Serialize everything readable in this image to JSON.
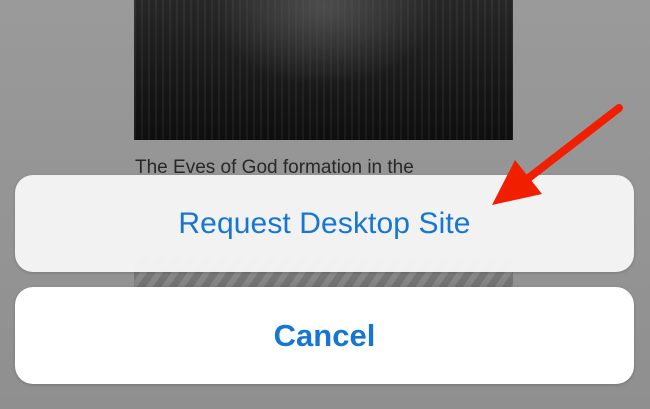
{
  "page": {
    "caption": "The Eves of God formation in the"
  },
  "actions": {
    "request_desktop_site_label": "Request Desktop Site",
    "cancel_label": "Cancel"
  },
  "annotation": {
    "arrow_icon": "red-arrow-icon",
    "arrow_color": "#f11e00"
  },
  "colors": {
    "action_text": "#1577d1",
    "action_background": "#f8f8f8",
    "cancel_background": "#ffffff",
    "page_background": "#9d9d9d"
  }
}
